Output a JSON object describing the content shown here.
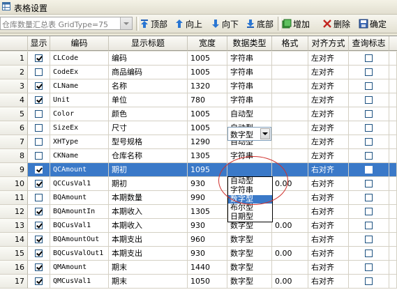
{
  "window": {
    "title": "表格设置"
  },
  "toolbar": {
    "grid_select": {
      "value": "仓库数量汇总表 GridType=75"
    },
    "buttons": [
      {
        "id": "top",
        "label": "顶部",
        "icon": "arrow-up-to-top-icon"
      },
      {
        "id": "up",
        "label": "向上",
        "icon": "arrow-up-icon"
      },
      {
        "id": "down",
        "label": "向下",
        "icon": "arrow-down-icon"
      },
      {
        "id": "bottom",
        "label": "底部",
        "icon": "arrow-down-to-bottom-icon"
      },
      {
        "id": "add",
        "label": "增加",
        "icon": "add-icon"
      },
      {
        "id": "delete",
        "label": "删除",
        "icon": "delete-x-icon"
      },
      {
        "id": "ok",
        "label": "确定",
        "icon": "save-icon"
      }
    ]
  },
  "grid": {
    "columns": [
      "",
      "显示",
      "编码",
      "显示标题",
      "宽度",
      "数据类型",
      "格式",
      "对齐方式",
      "查询标志"
    ],
    "rows": [
      {
        "n": "1",
        "show": true,
        "code": "CLCode",
        "title": "编码",
        "width": "1005",
        "type": "字符串",
        "fmt": "",
        "align": "左对齐",
        "query": false
      },
      {
        "n": "2",
        "show": false,
        "code": "CodeEx",
        "title": "商品编码",
        "width": "1005",
        "type": "字符串",
        "fmt": "",
        "align": "左对齐",
        "query": false
      },
      {
        "n": "3",
        "show": true,
        "code": "CLName",
        "title": "名称",
        "width": "1320",
        "type": "字符串",
        "fmt": "",
        "align": "左对齐",
        "query": false
      },
      {
        "n": "4",
        "show": true,
        "code": "Unit",
        "title": "单位",
        "width": "780",
        "type": "字符串",
        "fmt": "",
        "align": "左对齐",
        "query": false
      },
      {
        "n": "5",
        "show": false,
        "code": "Color",
        "title": "颜色",
        "width": "1005",
        "type": "自动型",
        "fmt": "",
        "align": "左对齐",
        "query": false
      },
      {
        "n": "6",
        "show": false,
        "code": "SizeEx",
        "title": "尺寸",
        "width": "1005",
        "type": "自动型",
        "fmt": "",
        "align": "左对齐",
        "query": false
      },
      {
        "n": "7",
        "show": false,
        "code": "XHType",
        "title": "型号规格",
        "width": "1290",
        "type": "自动型",
        "fmt": "",
        "align": "左对齐",
        "query": false
      },
      {
        "n": "8",
        "show": false,
        "code": "CKName",
        "title": "仓库名称",
        "width": "1305",
        "type": "字符串",
        "fmt": "",
        "align": "左对齐",
        "query": false
      },
      {
        "n": "9",
        "show": true,
        "code": "QCAmount",
        "title": "期初",
        "width": "1095",
        "type": "数字型",
        "fmt": "",
        "align": "右对齐",
        "query": false
      },
      {
        "n": "10",
        "show": true,
        "code": "QCCusVal1",
        "title": "期初",
        "width": "930",
        "type": "数字型",
        "fmt": "0.00",
        "align": "右对齐",
        "query": false
      },
      {
        "n": "11",
        "show": false,
        "code": "BQAmount",
        "title": "本期数量",
        "width": "990",
        "type": "数字型",
        "fmt": "",
        "align": "右对齐",
        "query": false
      },
      {
        "n": "12",
        "show": true,
        "code": "BQAmountIn",
        "title": "本期收入",
        "width": "1305",
        "type": "数字型",
        "fmt": "",
        "align": "右对齐",
        "query": false
      },
      {
        "n": "13",
        "show": true,
        "code": "BQCusVal1",
        "title": "本期收入",
        "width": "930",
        "type": "数字型",
        "fmt": "0.00",
        "align": "右对齐",
        "query": false
      },
      {
        "n": "14",
        "show": true,
        "code": "BQAmountOut",
        "title": "本期支出",
        "width": "960",
        "type": "数字型",
        "fmt": "",
        "align": "右对齐",
        "query": false
      },
      {
        "n": "15",
        "show": true,
        "code": "BQCusValOut1",
        "title": "本期支出",
        "width": "930",
        "type": "数字型",
        "fmt": "0.00",
        "align": "右对齐",
        "query": false
      },
      {
        "n": "16",
        "show": true,
        "code": "QMAmount",
        "title": "期末",
        "width": "1440",
        "type": "数字型",
        "fmt": "",
        "align": "右对齐",
        "query": false
      },
      {
        "n": "17",
        "show": true,
        "code": "QMCusVal1",
        "title": "期末",
        "width": "1050",
        "type": "数字型",
        "fmt": "0.00",
        "align": "右对齐",
        "query": false
      }
    ],
    "selected_row": 8
  },
  "type_editor": {
    "value": "数字型",
    "options": [
      "自动型",
      "字符串",
      "数字型",
      "布尔型",
      "日期型"
    ],
    "highlighted": 2
  },
  "colors": {
    "selection": "#3a79c8",
    "annotation": "#d0312d"
  }
}
